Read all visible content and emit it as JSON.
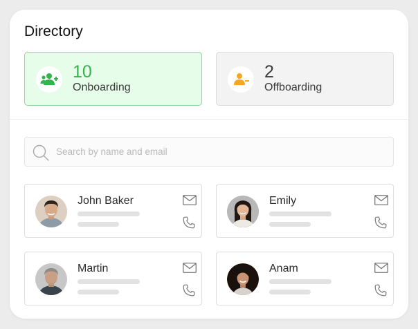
{
  "header": {
    "title": "Directory"
  },
  "stats": [
    {
      "count": "10",
      "label": "Onboarding",
      "icon": "user-add-icon",
      "accent": "#33b44a"
    },
    {
      "count": "2",
      "label": "Offboarding",
      "icon": "user-remove-icon",
      "accent": "#f5a623"
    }
  ],
  "search": {
    "placeholder": "Search by name and email",
    "icon": "search-icon"
  },
  "people": [
    {
      "name": "John Baker"
    },
    {
      "name": "Emily"
    },
    {
      "name": "Martin"
    },
    {
      "name": "Anam"
    }
  ],
  "icons": {
    "mail": "mail-icon",
    "phone": "phone-icon"
  }
}
